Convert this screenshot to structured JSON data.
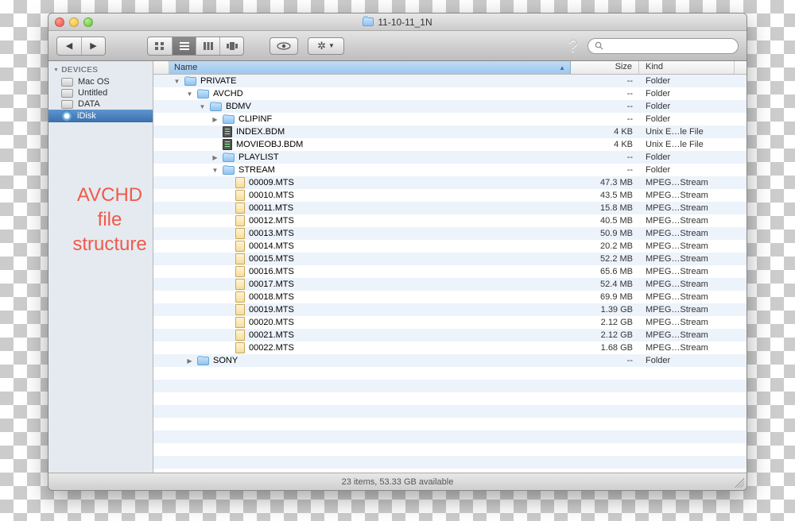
{
  "window_title": "11-10-11_1N",
  "annotation": "AVCHD\nfile\nstructure",
  "toolbar": {
    "search_placeholder": ""
  },
  "sidebar": {
    "header": "DEVICES",
    "items": [
      {
        "label": "Mac OS",
        "icon": "drive",
        "selected": false
      },
      {
        "label": "Untitled",
        "icon": "drive",
        "selected": false
      },
      {
        "label": "DATA",
        "icon": "drive",
        "selected": false
      },
      {
        "label": "iDisk",
        "icon": "idisk",
        "selected": true
      }
    ]
  },
  "columns": {
    "name": "Name",
    "size": "Size",
    "kind": "Kind"
  },
  "rows": [
    {
      "indent": 0,
      "disc": "down",
      "icon": "folder",
      "name": "PRIVATE",
      "size": "--",
      "kind": "Folder"
    },
    {
      "indent": 1,
      "disc": "down",
      "icon": "folder",
      "name": "AVCHD",
      "size": "--",
      "kind": "Folder"
    },
    {
      "indent": 2,
      "disc": "down",
      "icon": "folder",
      "name": "BDMV",
      "size": "--",
      "kind": "Folder"
    },
    {
      "indent": 3,
      "disc": "right",
      "icon": "folder",
      "name": "CLIPINF",
      "size": "--",
      "kind": "Folder"
    },
    {
      "indent": 3,
      "disc": "",
      "icon": "unix",
      "name": "INDEX.BDM",
      "size": "4 KB",
      "kind": "Unix E…le File"
    },
    {
      "indent": 3,
      "disc": "",
      "icon": "unix",
      "name": "MOVIEOBJ.BDM",
      "size": "4 KB",
      "kind": "Unix E…le File"
    },
    {
      "indent": 3,
      "disc": "right",
      "icon": "folder",
      "name": "PLAYLIST",
      "size": "--",
      "kind": "Folder"
    },
    {
      "indent": 3,
      "disc": "down",
      "icon": "folder",
      "name": "STREAM",
      "size": "--",
      "kind": "Folder"
    },
    {
      "indent": 4,
      "disc": "",
      "icon": "media",
      "name": "00009.MTS",
      "size": "47.3 MB",
      "kind": "MPEG…Stream"
    },
    {
      "indent": 4,
      "disc": "",
      "icon": "media",
      "name": "00010.MTS",
      "size": "43.5 MB",
      "kind": "MPEG…Stream"
    },
    {
      "indent": 4,
      "disc": "",
      "icon": "media",
      "name": "00011.MTS",
      "size": "15.8 MB",
      "kind": "MPEG…Stream"
    },
    {
      "indent": 4,
      "disc": "",
      "icon": "media",
      "name": "00012.MTS",
      "size": "40.5 MB",
      "kind": "MPEG…Stream"
    },
    {
      "indent": 4,
      "disc": "",
      "icon": "media",
      "name": "00013.MTS",
      "size": "50.9 MB",
      "kind": "MPEG…Stream"
    },
    {
      "indent": 4,
      "disc": "",
      "icon": "media",
      "name": "00014.MTS",
      "size": "20.2 MB",
      "kind": "MPEG…Stream"
    },
    {
      "indent": 4,
      "disc": "",
      "icon": "media",
      "name": "00015.MTS",
      "size": "52.2 MB",
      "kind": "MPEG…Stream"
    },
    {
      "indent": 4,
      "disc": "",
      "icon": "media",
      "name": "00016.MTS",
      "size": "65.6 MB",
      "kind": "MPEG…Stream"
    },
    {
      "indent": 4,
      "disc": "",
      "icon": "media",
      "name": "00017.MTS",
      "size": "52.4 MB",
      "kind": "MPEG…Stream"
    },
    {
      "indent": 4,
      "disc": "",
      "icon": "media",
      "name": "00018.MTS",
      "size": "69.9 MB",
      "kind": "MPEG…Stream"
    },
    {
      "indent": 4,
      "disc": "",
      "icon": "media",
      "name": "00019.MTS",
      "size": "1.39 GB",
      "kind": "MPEG…Stream"
    },
    {
      "indent": 4,
      "disc": "",
      "icon": "media",
      "name": "00020.MTS",
      "size": "2.12 GB",
      "kind": "MPEG…Stream"
    },
    {
      "indent": 4,
      "disc": "",
      "icon": "media",
      "name": "00021.MTS",
      "size": "2.12 GB",
      "kind": "MPEG…Stream"
    },
    {
      "indent": 4,
      "disc": "",
      "icon": "media",
      "name": "00022.MTS",
      "size": "1.68 GB",
      "kind": "MPEG…Stream"
    },
    {
      "indent": 1,
      "disc": "right",
      "icon": "folder",
      "name": "SONY",
      "size": "--",
      "kind": "Folder"
    }
  ],
  "status": "23 items, 53.33 GB available"
}
